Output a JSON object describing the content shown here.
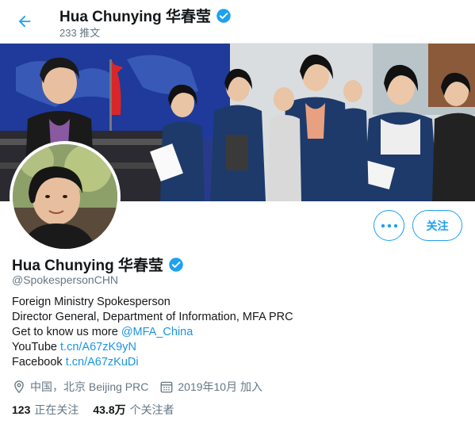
{
  "header": {
    "name": "Hua Chunying 华春莹",
    "tweet_count": "233 推文"
  },
  "profile": {
    "name": "Hua Chunying 华春莹",
    "handle": "@SpokespersonCHN",
    "follow_label": "关注",
    "more_icon": "more-icon",
    "verified_icon": "verified-badge-icon"
  },
  "bio": {
    "line1": "Foreign Ministry Spokesperson",
    "line2": "Director General, Department of Information, MFA PRC",
    "line3_text": "Get to know us more ",
    "line3_link": "@MFA_China",
    "line4_text": "YouTube ",
    "line4_link": "t.cn/A67zK9yN",
    "line5_text": "Facebook ",
    "line5_link": "t.cn/A67zKuDi"
  },
  "meta": {
    "location": "中国，北京 Beijing PRC",
    "joined": "2019年10月 加入"
  },
  "stats": {
    "following_count": "123",
    "following_label": "正在关注",
    "followers_count": "43.8万",
    "followers_label": "个关注者"
  },
  "colors": {
    "accent": "#1da1f2",
    "link": "#1b95e0",
    "muted": "#657786"
  }
}
